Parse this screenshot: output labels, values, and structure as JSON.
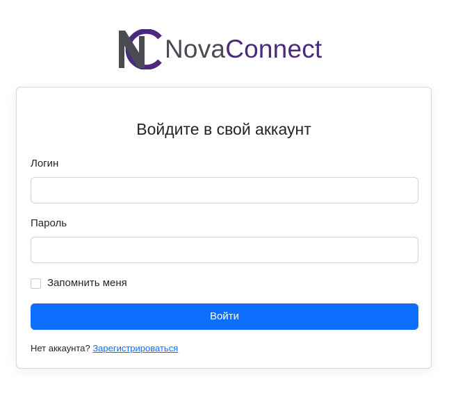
{
  "brand": {
    "name_part1": "Nova",
    "name_part2": "Connect",
    "logo_icon": "nc-monogram-icon",
    "colors": {
      "dark": "#4a4a52",
      "purple": "#4b2a7e"
    }
  },
  "login_form": {
    "title": "Войдите в свой аккаунт",
    "login_label": "Логин",
    "login_value": "",
    "password_label": "Пароль",
    "password_value": "",
    "remember_label": "Запомнить меня",
    "remember_checked": false,
    "submit_label": "Войти",
    "no_account_text": "Нет аккаунта?",
    "register_link": "Зарегистрироваться"
  },
  "colors": {
    "primary": "#0d6efd",
    "border": "#ced4da",
    "text": "#212529"
  }
}
